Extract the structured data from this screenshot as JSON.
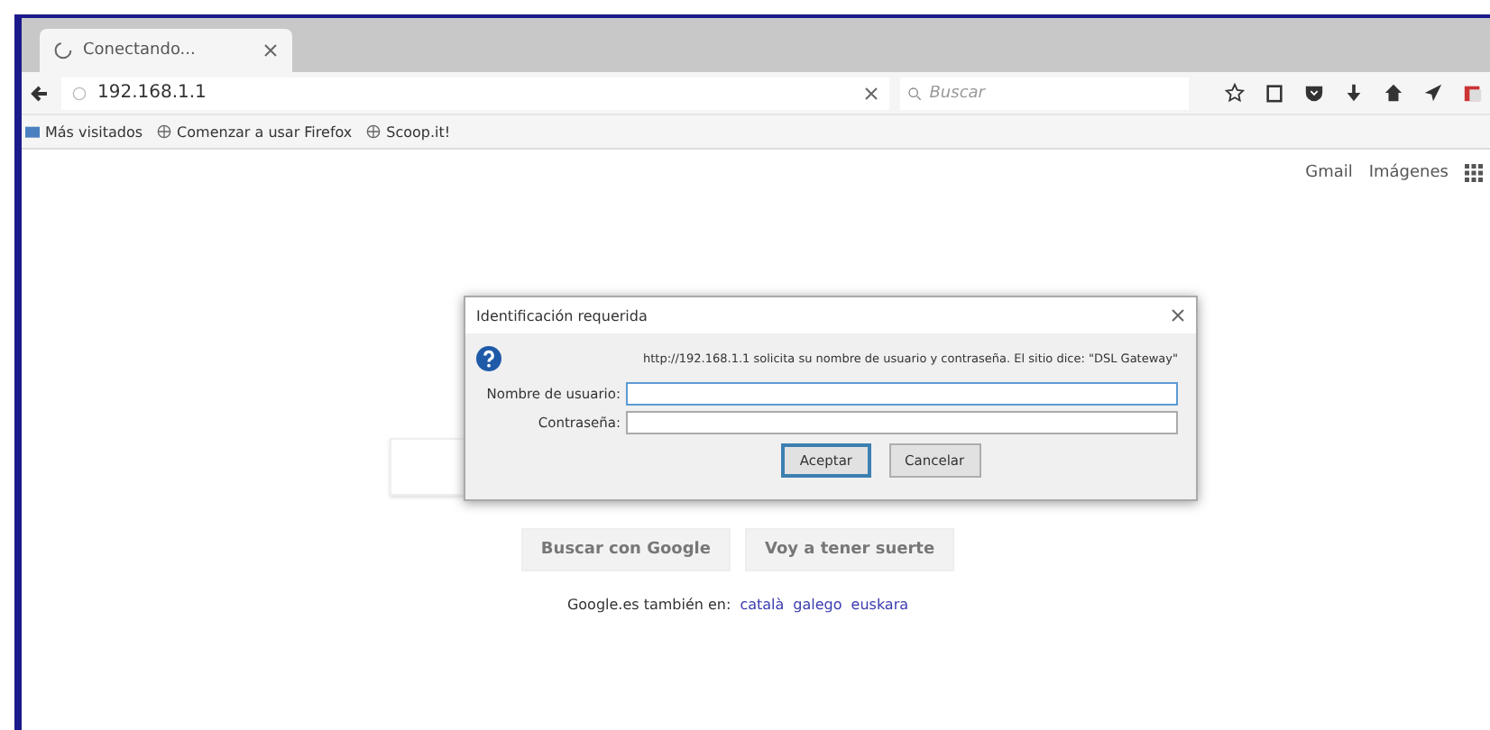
{
  "tab": {
    "title": "Conectando...",
    "loading": true
  },
  "nav": {
    "url": "192.168.1.1",
    "search_placeholder": "Buscar"
  },
  "bookmarks": [
    {
      "label": "Más visitados",
      "kind": "folder"
    },
    {
      "label": "Comenzar a usar Firefox",
      "kind": "site"
    },
    {
      "label": "Scoop.it!",
      "kind": "site"
    }
  ],
  "google": {
    "header_links": [
      "Gmail",
      "Imágenes"
    ],
    "buttons": [
      "Buscar con Google",
      "Voy a tener suerte"
    ],
    "footer_prefix": "Google.es también en:",
    "languages": [
      "català",
      "galego",
      "euskara"
    ]
  },
  "dialog": {
    "title": "Identificación requerida",
    "message": "http://192.168.1.1 solicita su nombre de usuario y contraseña. El sitio dice: \"DSL Gateway\"",
    "fields": [
      {
        "label": "Nombre de usuario:",
        "focused": true
      },
      {
        "label": "Contraseña:",
        "focused": false
      }
    ],
    "buttons": [
      {
        "label": "Aceptar",
        "default": true
      },
      {
        "label": "Cancelar",
        "default": false
      }
    ]
  }
}
